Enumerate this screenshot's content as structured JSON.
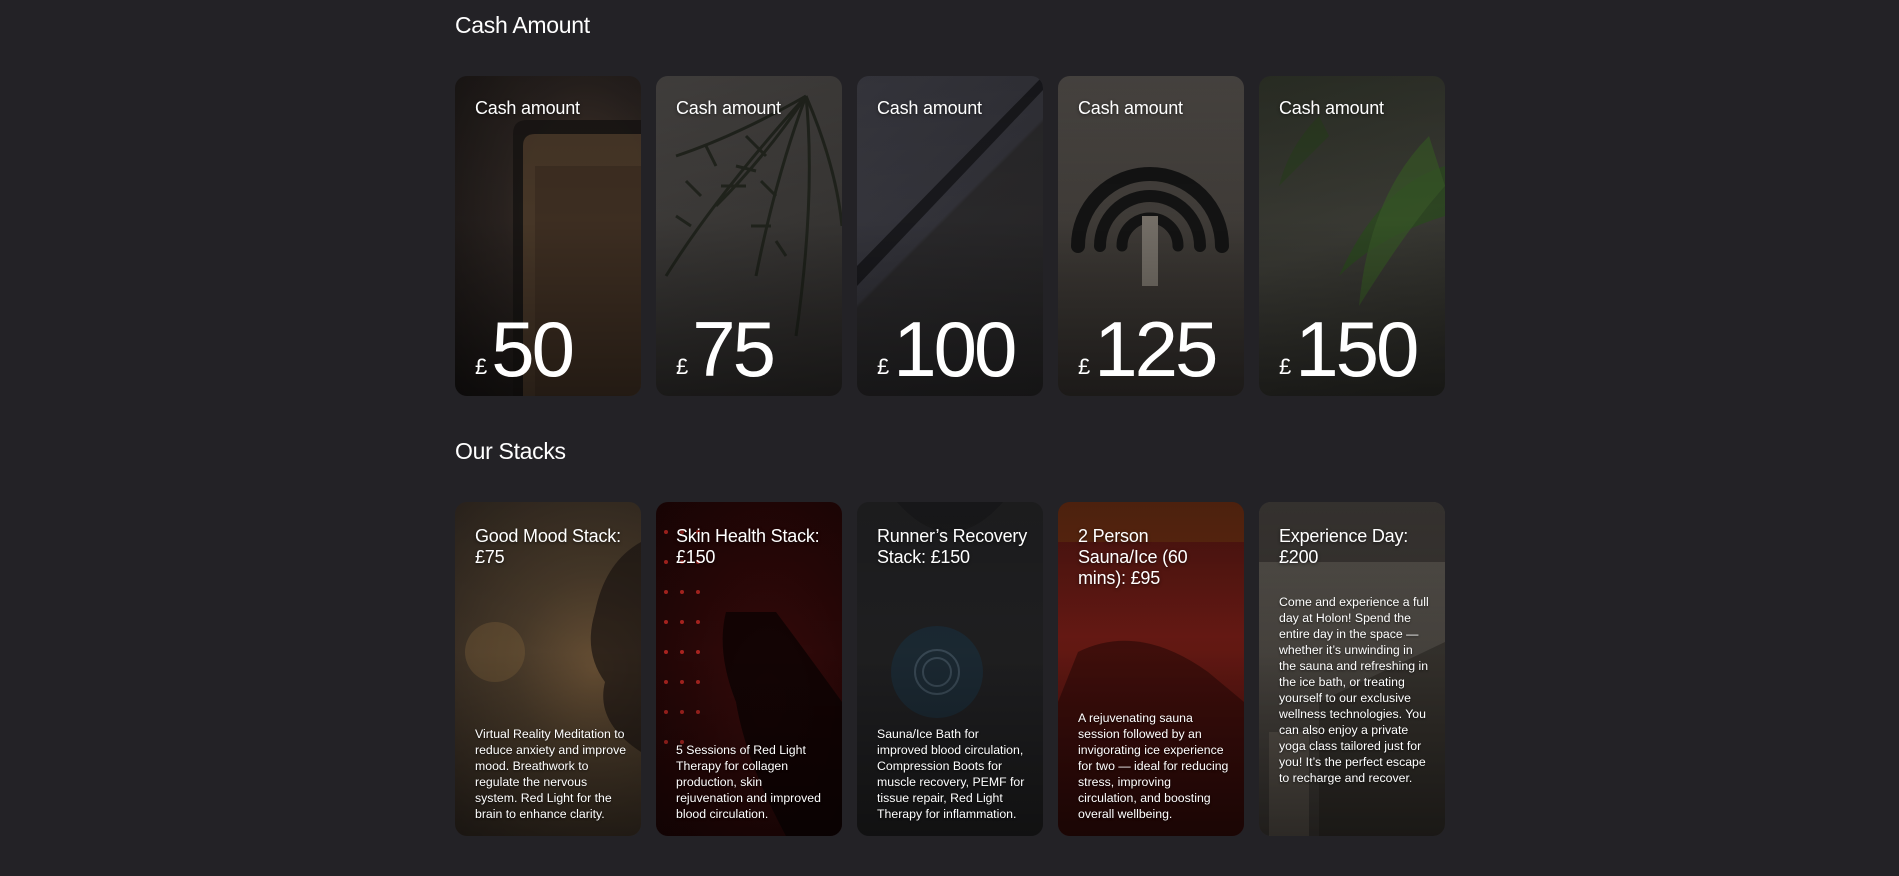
{
  "sections": {
    "cash_title": "Cash Amount",
    "stacks_title": "Our Stacks"
  },
  "cash_cards": [
    {
      "label": "Cash amount",
      "currency": "£",
      "amount": "50"
    },
    {
      "label": "Cash amount",
      "currency": "£",
      "amount": "75"
    },
    {
      "label": "Cash amount",
      "currency": "£",
      "amount": "100"
    },
    {
      "label": "Cash amount",
      "currency": "£",
      "amount": "125"
    },
    {
      "label": "Cash amount",
      "currency": "£",
      "amount": "150"
    }
  ],
  "stacks": [
    {
      "title": "Good Mood Stack: £75",
      "description": "Virtual Reality Meditation to reduce anxiety and improve mood. Breathwork to regulate the nervous system. Red Light for the brain to enhance clarity."
    },
    {
      "title": "Skin Health Stack: £150",
      "description": "5 Sessions of Red Light Therapy for collagen production, skin rejuvenation and improved blood circulation."
    },
    {
      "title": "Runner’s Recovery Stack: £150",
      "description": "Sauna/Ice Bath for improved blood circulation, Compression Boots for muscle recovery, PEMF for tissue repair, Red Light Therapy for inflammation."
    },
    {
      "title": "2 Person Sauna/Ice (60 mins): £95",
      "description": "A rejuvenating sauna session followed by an invigorating ice experience for two — ideal for reducing stress, improving circulation, and boosting overall wellbeing."
    },
    {
      "title": "Experience Day: £200",
      "description": "Come and experience a full day at Holon! Spend the entire day in the space —whether it’s unwinding in the sauna and refreshing in the ice bath, or treating yourself to our exclusive wellness technologies. You can also enjoy a private yoga class tailored just for you! It’s the perfect escape to recharge and recover."
    }
  ],
  "colors": {
    "page_background": "#232226",
    "text": "#ffffff"
  }
}
